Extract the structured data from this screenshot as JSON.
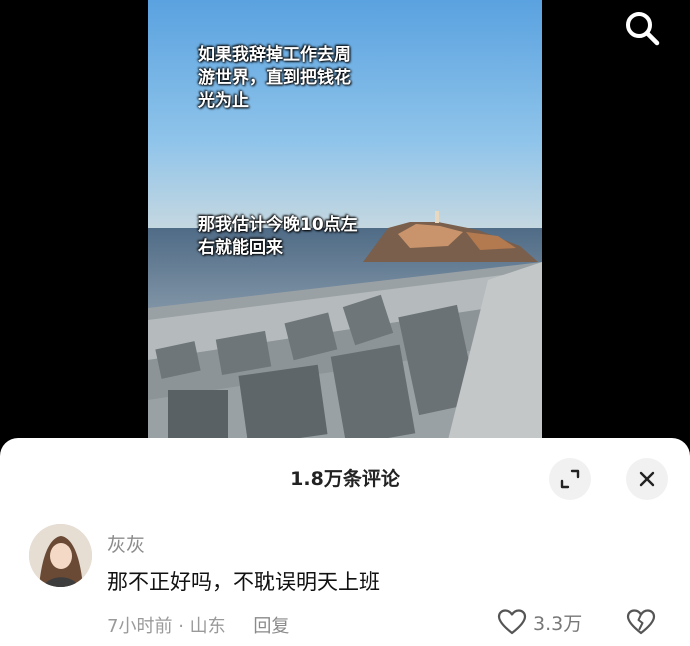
{
  "video": {
    "caption_top": "如果我辞掉工作去周\n游世界，直到把钱花\n光为止",
    "caption_middle": "那我估计今晚10点左\n右就能回来"
  },
  "header": {
    "search_icon": "search-icon"
  },
  "comments_panel": {
    "title": "1.8万条评论",
    "expand_icon": "expand-icon",
    "close_icon": "close-icon",
    "comment": {
      "username": "灰灰",
      "text": "那不正好吗，不耽误明天上班",
      "time": "7小时前",
      "location": "山东",
      "separator": "·",
      "reply_label": "回复",
      "like_count": "3.3万"
    }
  }
}
